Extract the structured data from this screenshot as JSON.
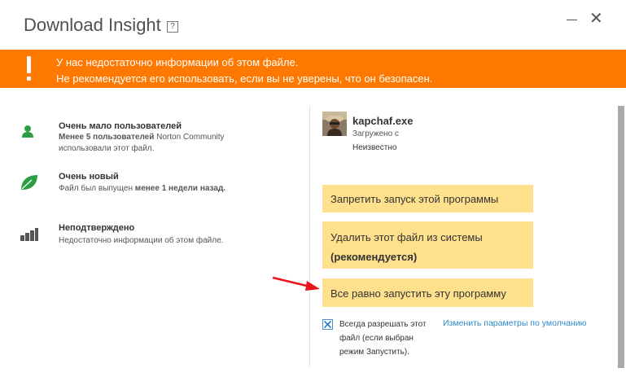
{
  "window": {
    "title": "Download Insight",
    "help_symbol": "?",
    "close_symbol": "✕"
  },
  "banner": {
    "line1": "У нас недостаточно информации об этом файле.",
    "line2": "Не рекомендуется его использовать, если вы не уверены, что он безопасен."
  },
  "info": {
    "users": {
      "heading": "Очень мало пользователей",
      "desc_bold": "Менее 5 пользователей",
      "desc_rest": " Norton Community",
      "desc_line2": "использовали этот файл.",
      "icon": "user-icon"
    },
    "age": {
      "heading": "Очень новый",
      "desc_start": "Файл был выпущен ",
      "desc_bold": "менее 1 недели назад.",
      "icon": "leaf-icon"
    },
    "stability": {
      "heading": "Неподтверждено",
      "desc": "Недостаточно информации об этом файле.",
      "icon": "signal-bars-icon"
    }
  },
  "file": {
    "name": "kapchaf.exe",
    "source_label": "Загружено с",
    "source_value": "Неизвестно"
  },
  "actions": {
    "block": "Запретить запуск этой программы",
    "delete_line1": "Удалить этот файл из системы",
    "delete_line2": "(рекомендуется)",
    "run": "Все равно запустить эту программу"
  },
  "options": {
    "always_allow_checked": true,
    "always_allow_line1": "Всегда разрешать этот",
    "always_allow_line2": "файл (если выбран",
    "always_allow_line3": "режим Запустить).",
    "defaults_link": "Изменить параметры по умолчанию"
  },
  "colors": {
    "banner": "#ff7800",
    "action_bg": "#ffe08c",
    "icon_green": "#2e9e46",
    "link": "#2f89c9",
    "arrow": "#e8131b"
  }
}
